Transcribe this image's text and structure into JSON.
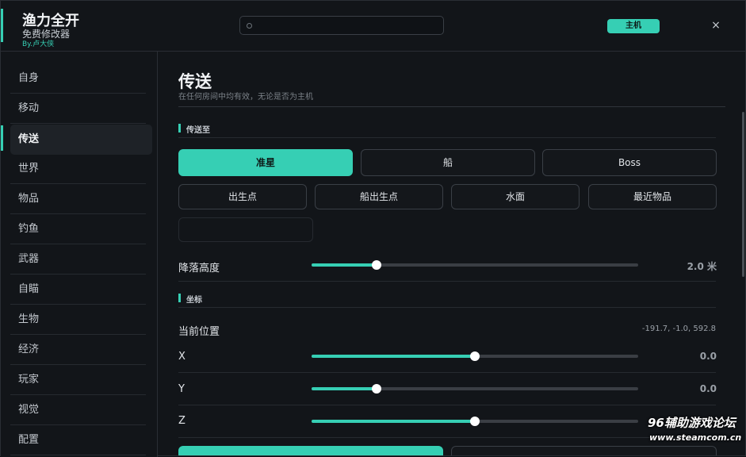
{
  "header": {
    "title": "渔力全开",
    "subtitle": "免费修改器",
    "author": "By.卢大侠",
    "search": {
      "value": "",
      "placeholder": ""
    },
    "host_label": "主机",
    "close_label": "×"
  },
  "sidebar": {
    "items": [
      {
        "label": "自身"
      },
      {
        "label": "移动"
      },
      {
        "label": "传送",
        "active": true
      },
      {
        "label": "世界"
      },
      {
        "label": "物品"
      },
      {
        "label": "钓鱼"
      },
      {
        "label": "武器"
      },
      {
        "label": "自瞄"
      },
      {
        "label": "生物"
      },
      {
        "label": "经济"
      },
      {
        "label": "玩家"
      },
      {
        "label": "视觉"
      },
      {
        "label": "配置"
      }
    ]
  },
  "main": {
    "title": "传送",
    "description": "在任何房间中均有效，无论是否为主机",
    "teleport_section": {
      "label": "传送至",
      "buttons_row1": [
        "准星",
        "船",
        "Boss"
      ],
      "buttons_row2": [
        "出生点",
        "船出生点",
        "水面",
        "最近物品"
      ],
      "disabled_button": "",
      "drop_height": {
        "label": "降落高度",
        "value_text": "2.0 米",
        "fraction": 0.2
      }
    },
    "coords_section": {
      "label": "坐标",
      "current_position_label": "当前位置",
      "current_position_value": "-191.7, -1.0, 592.8",
      "axes": [
        {
          "label": "X",
          "value_text": "0.0",
          "fraction": 0.5
        },
        {
          "label": "Y",
          "value_text": "0.0",
          "fraction": 0.2
        },
        {
          "label": "Z",
          "value_text": "",
          "fraction": 0.5
        }
      ]
    }
  },
  "watermark": {
    "line1": "96辅助游戏论坛",
    "line2": "www.steamcom.cn"
  },
  "colors": {
    "accent": "#36cfb4",
    "background": "#121519",
    "border": "#2a2e34"
  }
}
